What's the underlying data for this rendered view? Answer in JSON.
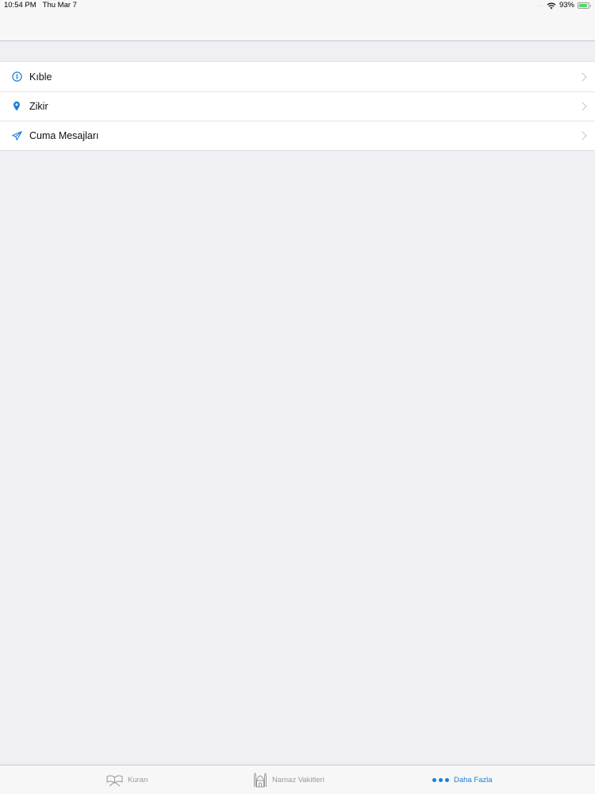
{
  "status_bar": {
    "time": "10:54 PM",
    "date": "Thu Mar 7",
    "signal": ".....",
    "battery_percent": "93%",
    "battery_level": 0.93
  },
  "menu": {
    "items": [
      {
        "label": "Kıble",
        "icon": "compass-icon"
      },
      {
        "label": "Zikir",
        "icon": "location-pin-icon"
      },
      {
        "label": "Cuma Mesajları",
        "icon": "paper-plane-icon"
      }
    ]
  },
  "tab_bar": {
    "tabs": [
      {
        "label": "Kuran",
        "icon": "quran-book-icon",
        "active": false
      },
      {
        "label": "Namaz Vakitleri",
        "icon": "mosque-icon",
        "active": false
      },
      {
        "label": "Daha Fazla",
        "icon": "more-dots-icon",
        "active": true
      }
    ]
  },
  "colors": {
    "accent": "#1c7ed6",
    "background": "#efeff4",
    "inactive_tab": "#9a9a9a",
    "battery": "#4cd964"
  }
}
